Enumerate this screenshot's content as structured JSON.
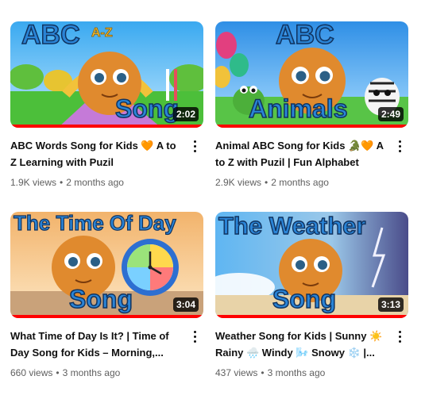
{
  "videos": [
    {
      "thumb_text_top": "ABC",
      "thumb_text_small": "A-Z",
      "thumb_text_bottom": "Song",
      "duration": "2:02",
      "title": "ABC Words Song for Kids 🧡 A to Z Learning with Puzil",
      "views": "1.9K views",
      "age": "2 months ago",
      "watched_fraction": 1.0
    },
    {
      "thumb_text_top": "ABC",
      "thumb_text_bottom": "Animals",
      "duration": "2:49",
      "title": "Animal ABC Song for Kids 🐊🧡 A to Z with Puzil | Fun Alphabet Animal...",
      "views": "2.9K views",
      "age": "2 months ago",
      "watched_fraction": 1.0
    },
    {
      "thumb_text_top": "The Time Of Day",
      "thumb_text_bottom": "Song",
      "clock_numbers": [
        "12",
        "1",
        "2",
        "3",
        "4",
        "5",
        "6",
        "7",
        "8",
        "9",
        "10",
        "11"
      ],
      "duration": "3:04",
      "title": "What Time of Day Is It? | Time of Day Song for Kids – Morning,...",
      "views": "660 views",
      "age": "3 months ago",
      "watched_fraction": 1.0
    },
    {
      "thumb_text_top": "The Weather",
      "thumb_text_bottom": "Song",
      "duration": "3:13",
      "title": "Weather Song for Kids | Sunny ☀️ Rainy 🌧️ Windy 🌬️ Snowy ❄️ |...",
      "views": "437 views",
      "age": "3 months ago",
      "watched_fraction": 1.0
    }
  ],
  "separator": "•",
  "colors": {
    "thumb_text_fill": "#2a84d6",
    "thumb_text_stroke": "#10325e",
    "progress": "#ff0000",
    "puzil": "#e08a2e"
  }
}
